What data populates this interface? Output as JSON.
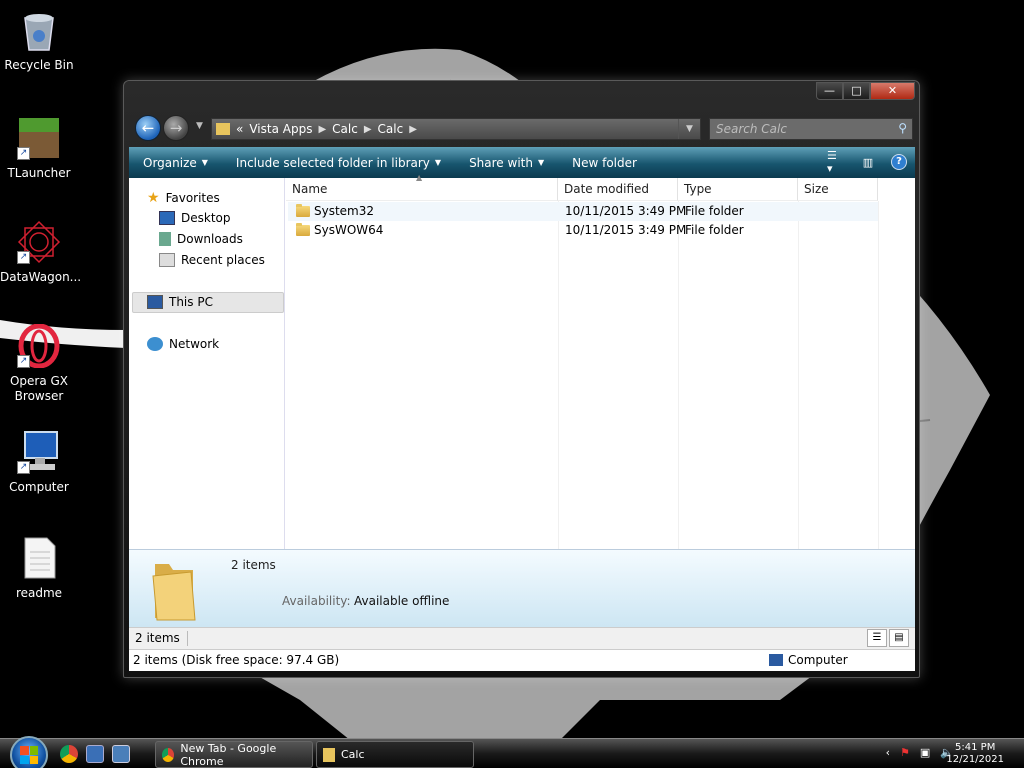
{
  "desktop": {
    "icons": [
      {
        "label": "Recycle Bin",
        "icon": "recycle-bin-icon"
      },
      {
        "label": "TLauncher",
        "icon": "grass-block-icon"
      },
      {
        "label": "DataWagon...",
        "icon": "red-web-icon"
      },
      {
        "label": "Opera GX Browser",
        "icon": "opera-gx-icon"
      },
      {
        "label": "Computer",
        "icon": "computer-icon"
      },
      {
        "label": "readme",
        "icon": "document-icon"
      }
    ]
  },
  "window": {
    "controls": {
      "minimize": "—",
      "maximize": "□",
      "close": "✕"
    },
    "address": {
      "overflow": "«",
      "crumbs": [
        "Vista Apps",
        "Calc",
        "Calc"
      ]
    },
    "search_placeholder": "Search Calc",
    "toolbar": {
      "organize": "Organize",
      "include": "Include selected folder in library",
      "share": "Share with",
      "new_folder": "New folder"
    },
    "nav": {
      "favorites": "Favorites",
      "desktop": "Desktop",
      "downloads": "Downloads",
      "recent": "Recent places",
      "thispc": "This PC",
      "network": "Network"
    },
    "columns": {
      "name": "Name",
      "date": "Date modified",
      "type": "Type",
      "size": "Size"
    },
    "files": [
      {
        "name": "System32",
        "date": "10/11/2015 3:49 PM",
        "type": "File folder",
        "size": ""
      },
      {
        "name": "SysWOW64",
        "date": "10/11/2015 3:49 PM",
        "type": "File folder",
        "size": ""
      }
    ],
    "details": {
      "count": "2 items",
      "availability_label": "Availability:",
      "availability_value": "Available offline"
    },
    "status": {
      "items": "2 items",
      "disk": "2 items (Disk free space: 97.4 GB)",
      "location": "Computer"
    }
  },
  "taskbar": {
    "tasks": [
      {
        "label": "New Tab - Google Chrome"
      },
      {
        "label": "Calc"
      }
    ],
    "tray_arrow": "‹",
    "time": "5:41 PM",
    "date": "12/21/2021"
  }
}
